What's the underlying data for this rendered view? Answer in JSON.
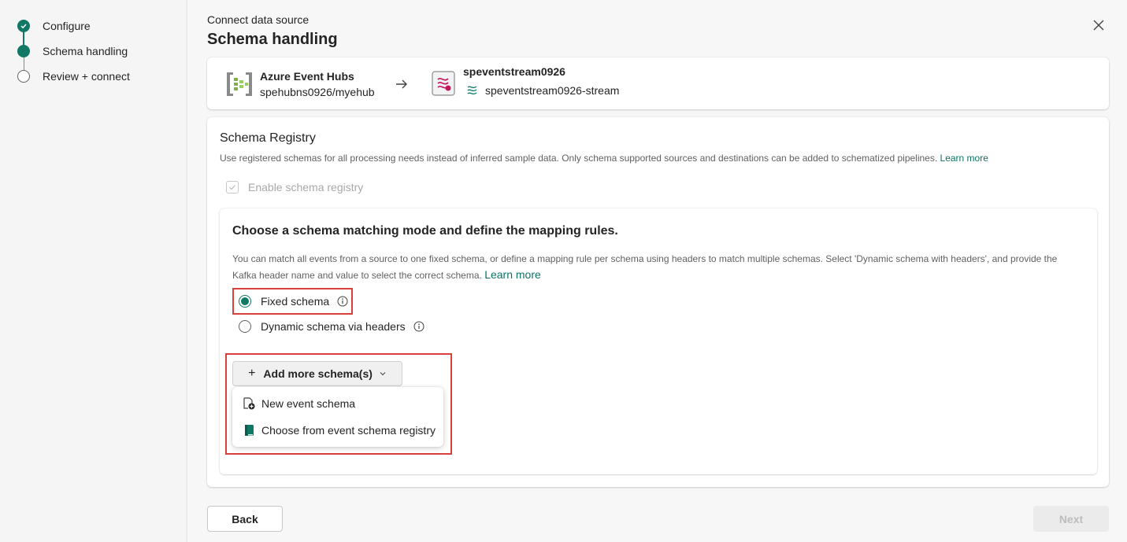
{
  "stepper": {
    "steps": [
      {
        "label": "Configure",
        "state": "done"
      },
      {
        "label": "Schema handling",
        "state": "current"
      },
      {
        "label": "Review + connect",
        "state": "todo"
      }
    ]
  },
  "header": {
    "breadcrumb": "Connect data source",
    "title": "Schema handling"
  },
  "connection": {
    "source_name": "Azure Event Hubs",
    "source_path": "spehubns0926/myehub",
    "destination_name": "speventstream0926",
    "destination_stream": "speventstream0926-stream"
  },
  "schema_registry": {
    "title": "Schema Registry",
    "description": "Use registered schemas for all processing needs instead of inferred sample data. Only schema supported sources and destinations can be added to schematized pipelines.",
    "learn_more": "Learn more",
    "enable_label": "Enable schema registry",
    "enable_checked": true
  },
  "mapping": {
    "title": "Choose a schema matching mode and define the mapping rules.",
    "description": "You can match all events from a source to one fixed schema, or define a mapping rule per schema using headers to match multiple schemas. Select 'Dynamic schema with headers', and provide the Kafka header name and value to select the correct schema.",
    "learn_more": "Learn more",
    "options": [
      {
        "label": "Fixed schema",
        "selected": true
      },
      {
        "label": "Dynamic schema via headers",
        "selected": false
      }
    ],
    "add_button": "Add more schema(s)",
    "menu_items": [
      "New event schema",
      "Choose from event schema registry"
    ]
  },
  "footer": {
    "back": "Back",
    "next": "Next"
  },
  "colors": {
    "accent": "#117865",
    "highlight": "#d9403c"
  }
}
